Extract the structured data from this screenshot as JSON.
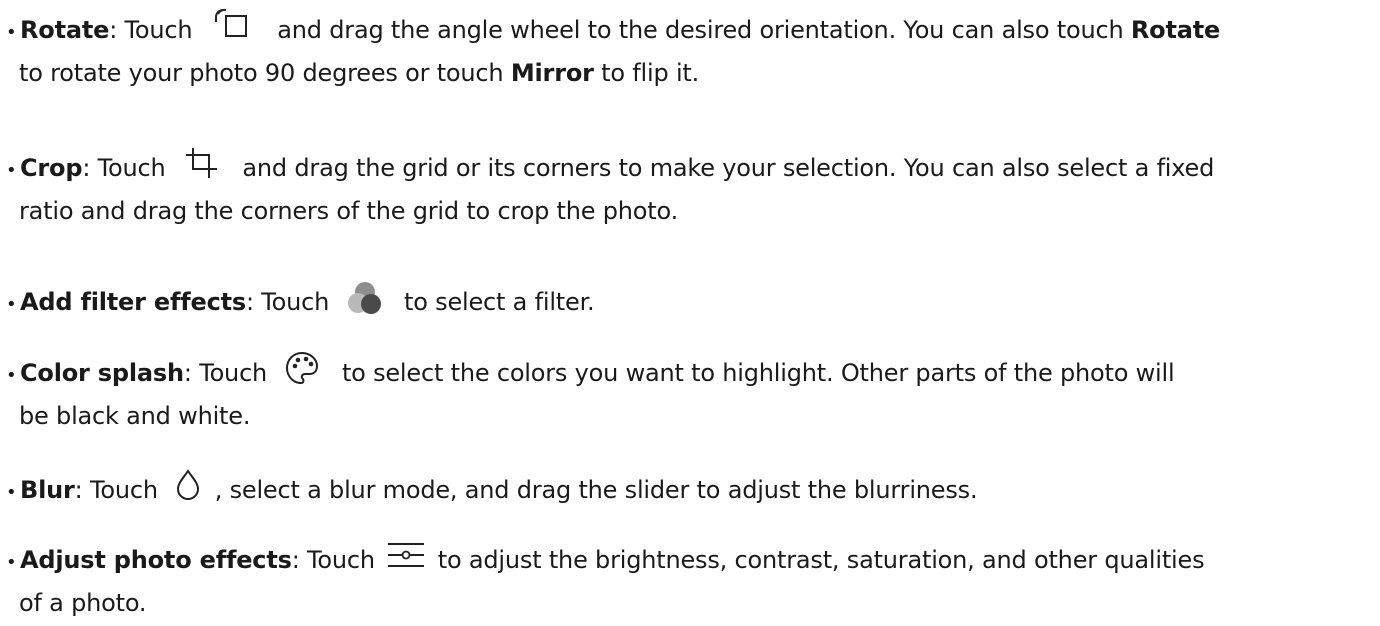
{
  "bullet": "•",
  "items": [
    {
      "title": "Rotate",
      "before_icon": ": Touch ",
      "icon": "rotate-icon",
      "line1_rest": " and drag the angle wheel to the desired orientation. You can also touch ",
      "bold_rotate": "Rotate",
      "line2_a": "to rotate your photo 90 degrees or touch ",
      "bold_mirror": "Mirror",
      "line2_b": " to flip it."
    },
    {
      "title": "Crop",
      "before_icon": ": Touch ",
      "icon": "crop-icon",
      "line1_rest": " and drag the grid or its corners to make your selection. You can also select a fixed",
      "line2": "ratio and drag the corners of the grid to crop the photo."
    },
    {
      "title": "Add filter effects",
      "before_icon": ": Touch ",
      "icon": "filter-icon",
      "line1_rest": " to select a filter."
    },
    {
      "title": "Color splash",
      "before_icon": ": Touch ",
      "icon": "palette-icon",
      "line1_rest": " to select the colors you want to highlight. Other parts of the photo will",
      "line2": "be black and white."
    },
    {
      "title": "Blur",
      "before_icon": ": Touch ",
      "icon": "blur-drop-icon",
      "line1_rest": " , select a blur mode, and drag the slider to adjust the blurriness."
    },
    {
      "title": "Adjust photo effects",
      "before_icon": ": Touch ",
      "icon": "adjust-slider-icon",
      "line1_rest": " to adjust the brightness, contrast, saturation, and other qualities",
      "line2": "of a photo."
    }
  ]
}
